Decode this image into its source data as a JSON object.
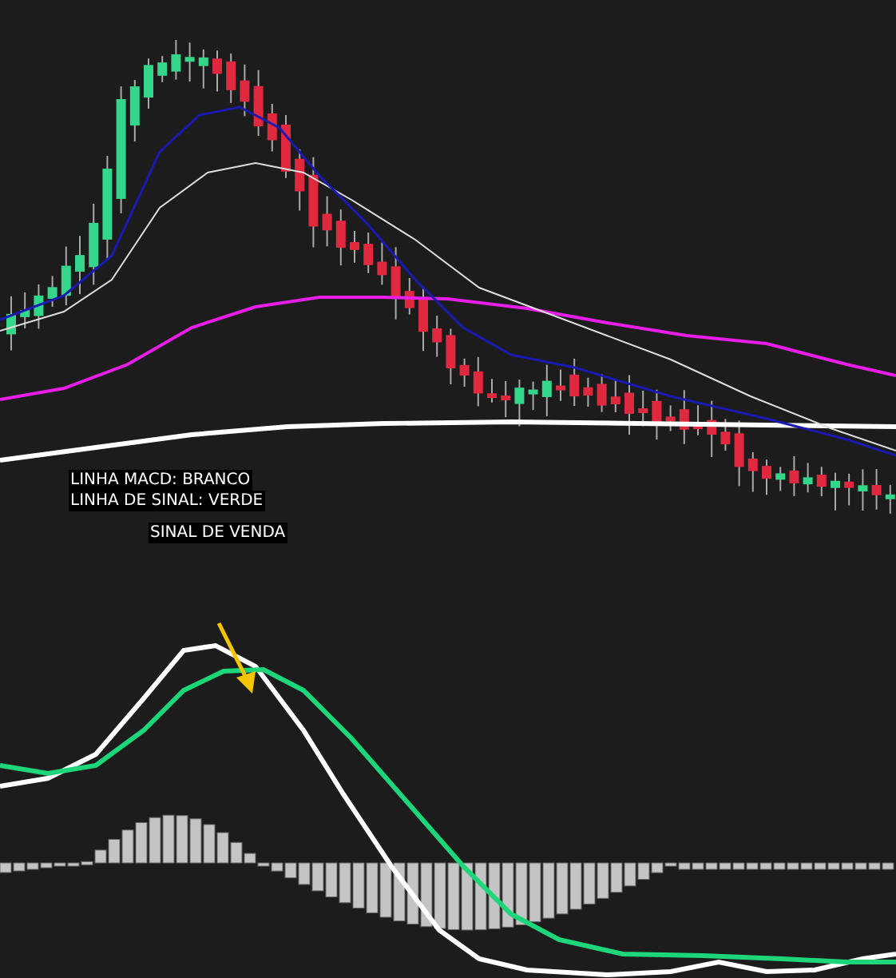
{
  "legend": [
    "LINHA MACD: BRANCO",
    "LINHA DE SINAL: VERDE"
  ],
  "signal_label": "SINAL DE VENDA"
}
